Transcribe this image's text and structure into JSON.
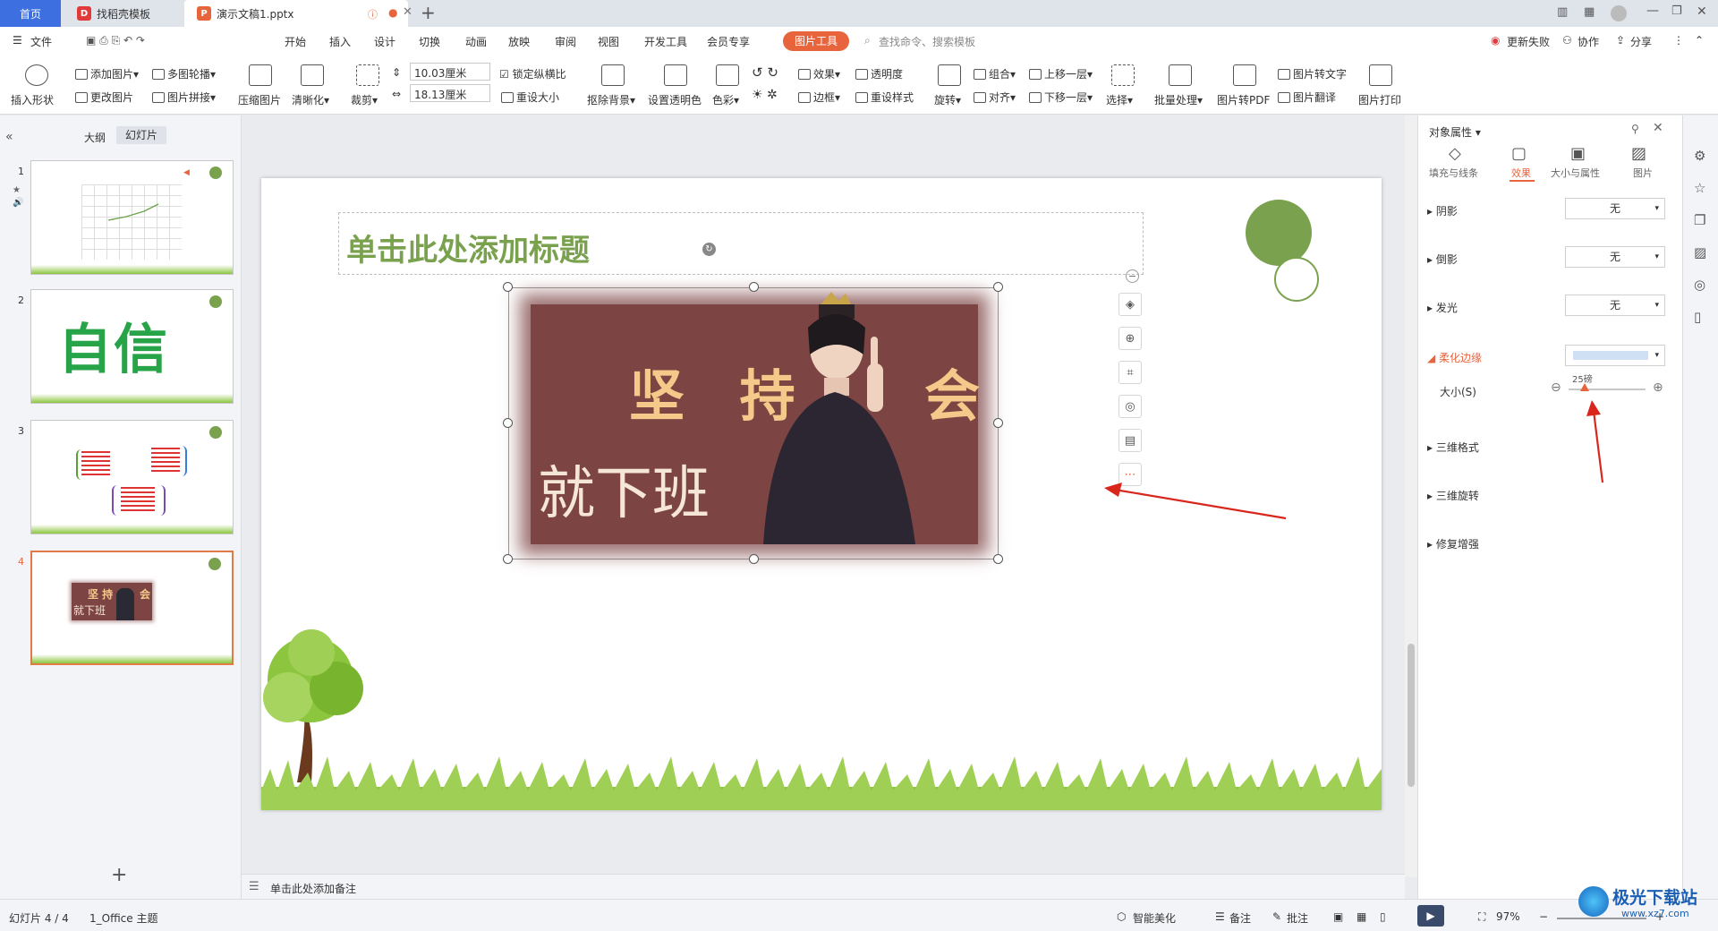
{
  "tabs": {
    "home": "首页",
    "template": "找稻壳模板",
    "document": "演示文稿1.pptx"
  },
  "menu": {
    "file": "文件",
    "items": [
      "开始",
      "插入",
      "设计",
      "切换",
      "动画",
      "放映",
      "审阅",
      "视图",
      "开发工具",
      "会员专享"
    ],
    "active_tool": "图片工具",
    "search_placeholder": "查找命令、搜索模板",
    "update_failed": "更新失败",
    "collab": "协作",
    "share": "分享"
  },
  "ribbon": {
    "insert_shape": "插入形状",
    "add_image": "添加图片",
    "multi_contour": "多图轮播",
    "change_image": "更改图片",
    "image_splice": "图片拼接",
    "compress": "压缩图片",
    "sharpen": "清晰化",
    "crop": "裁剪",
    "width": "10.03厘米",
    "height": "18.13厘米",
    "lock_ratio": "锁定纵横比",
    "reset_size": "重设大小",
    "remove_bg": "抠除背景",
    "set_transparent": "设置透明色",
    "color": "色彩",
    "effects": "效果",
    "transparency": "透明度",
    "border": "边框",
    "reset_style": "重设样式",
    "rotate": "旋转",
    "group": "组合",
    "align": "对齐",
    "bring_forward": "上移一层",
    "send_backward": "下移一层",
    "select": "选择",
    "batch": "批量处理",
    "to_pdf": "图片转PDF",
    "to_text": "图片转文字",
    "translate": "图片翻译",
    "print": "图片打印"
  },
  "leftpane": {
    "tab_outline": "大纲",
    "tab_slides": "幻灯片",
    "thumbs": [
      {
        "num": "1"
      },
      {
        "num": "2",
        "text": "自信"
      },
      {
        "num": "3"
      },
      {
        "num": "4",
        "text_a": "坚  持",
        "text_b": "会",
        "text_c": "就下班"
      }
    ]
  },
  "slide": {
    "title": "单击此处添加标题",
    "pic_text_top": "坚 持",
    "pic_text_right": "会",
    "pic_text_bottom": "就下班"
  },
  "notes": {
    "placeholder": "单击此处添加备注"
  },
  "rpanel": {
    "title": "对象属性",
    "tabs": [
      "填充与线条",
      "效果",
      "大小与属性",
      "图片"
    ],
    "rows": {
      "shadow": "阴影",
      "reflection": "倒影",
      "glow": "发光",
      "soft_edge": "柔化边缘",
      "size_label": "大小(S)",
      "size_value": "25磅",
      "three_d_format": "三维格式",
      "three_d_rotation": "三维旋转",
      "repair": "修复增强",
      "none": "无"
    }
  },
  "status": {
    "slide_info": "幻灯片 4 / 4",
    "theme": "1_Office 主题",
    "beautify": "智能美化",
    "notes": "备注",
    "comments": "批注",
    "zoom": "97%"
  },
  "watermark": {
    "text": "极光下载站",
    "url": "www.xz7.com"
  },
  "colors": {
    "accent": "#3d6fe0",
    "tool_tab": "#e8643c",
    "title_green": "#7aa24e",
    "picture_bg": "#7d4444",
    "arrow_red": "#d9261c"
  }
}
